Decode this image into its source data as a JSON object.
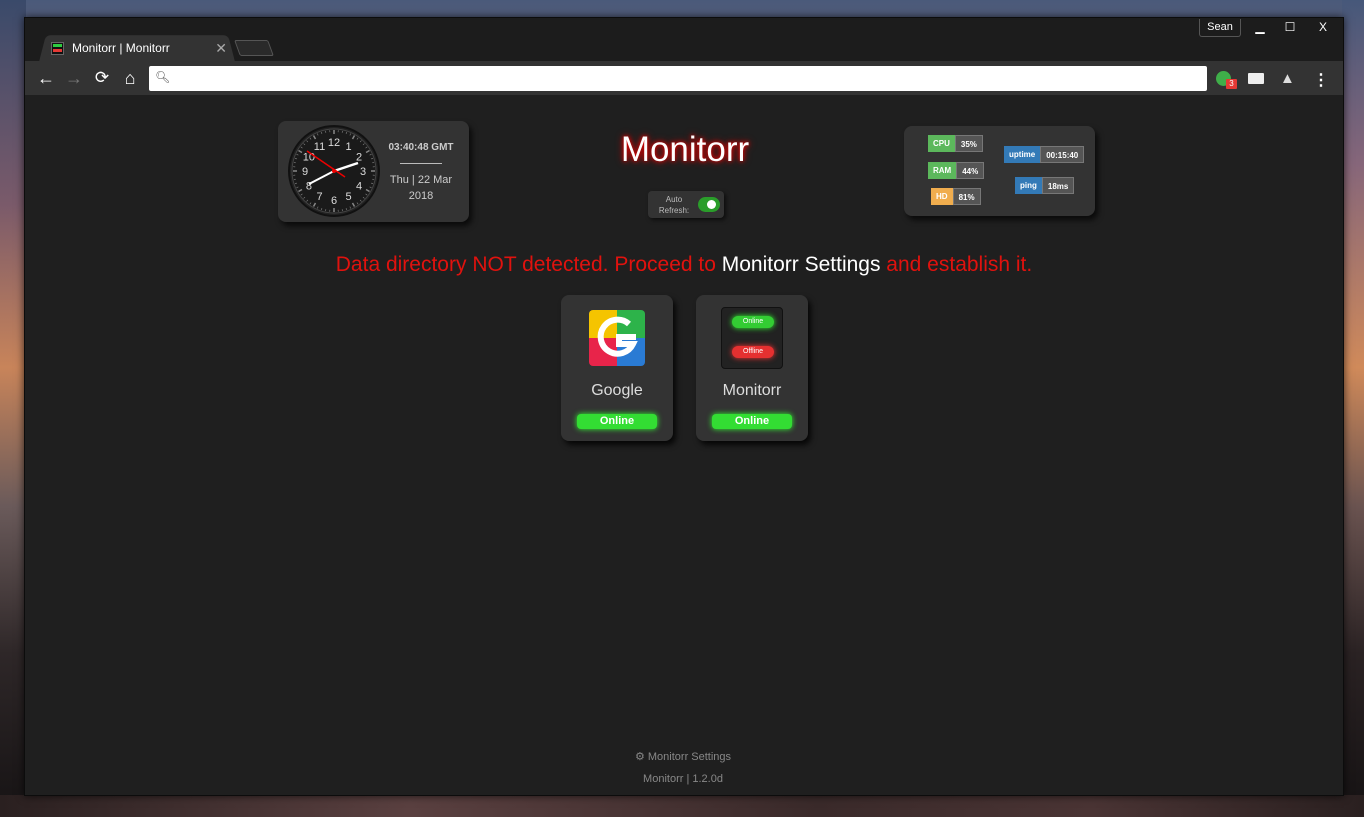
{
  "browser": {
    "profile": "Sean",
    "controls": {
      "minimize": "▁",
      "maximize": "☐",
      "close": "X"
    },
    "tab": {
      "title": "Monitorr | Monitorr",
      "close": "✕"
    },
    "nav": {
      "back": "←",
      "forward": "→",
      "reload": "⟳",
      "home": "⌂"
    },
    "omnibox": {
      "value": "",
      "placeholder": ""
    },
    "extensions": {
      "monitorr_badge": "3",
      "menu": "⋮",
      "drive": "▲"
    }
  },
  "clock": {
    "time": "03:40:48 GMT",
    "date_line1": "Thu | 22 Mar",
    "date_line2": "2018",
    "numbers": [
      "12",
      "1",
      "2",
      "3",
      "4",
      "5",
      "6",
      "7",
      "8",
      "9",
      "10",
      "11"
    ]
  },
  "header": {
    "title": "Monitorr",
    "auto_refresh_line1": "Auto",
    "auto_refresh_line2": "Refresh:",
    "auto_refresh_on": true
  },
  "stats": {
    "cpu": {
      "label": "CPU",
      "value": "35%",
      "color": "#5cb85c"
    },
    "ram": {
      "label": "RAM",
      "value": "44%",
      "color": "#5cb85c"
    },
    "hd": {
      "label": "HD",
      "value": "81%",
      "color": "#f0ad4e"
    },
    "uptime": {
      "label": "uptime",
      "value": "00:15:40",
      "color": "#337ab7"
    },
    "ping": {
      "label": "ping",
      "value": "18ms",
      "color": "#337ab7"
    }
  },
  "error": {
    "part1": "Data directory NOT detected. Proceed to ",
    "link": "Monitorr Settings",
    "part2": " and establish it."
  },
  "services": [
    {
      "name": "Google",
      "status": "Online"
    },
    {
      "name": "Monitorr",
      "status": "Online",
      "logo_online": "Online",
      "logo_offline": "Offline"
    }
  ],
  "footer": {
    "settings": "⚙ Monitorr Settings",
    "version": "Monitorr | 1.2.0d"
  }
}
